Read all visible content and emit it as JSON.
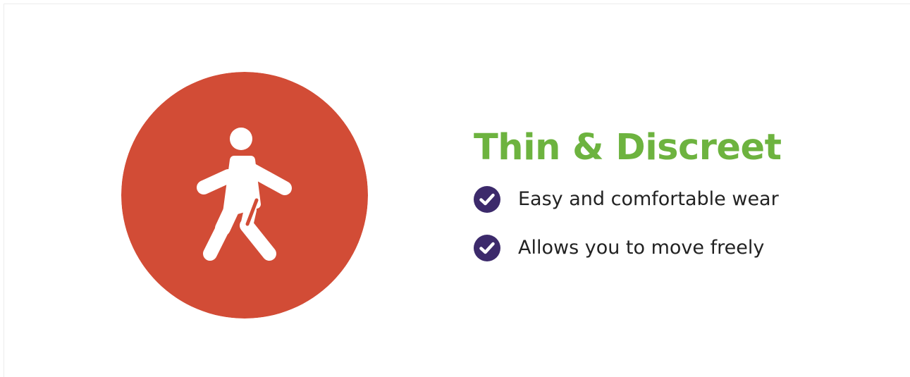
{
  "colors": {
    "accent_green": "#6db33f",
    "circle_red": "#d24c36",
    "check_purple": "#3c2a6b",
    "text_dark": "#222222"
  },
  "hero": {
    "icon": "walking-person-icon"
  },
  "headline": "Thin & Discreet",
  "features": [
    {
      "icon": "check-circle-icon",
      "label": "Easy and comfortable wear"
    },
    {
      "icon": "check-circle-icon",
      "label": "Allows you to move freely"
    }
  ]
}
